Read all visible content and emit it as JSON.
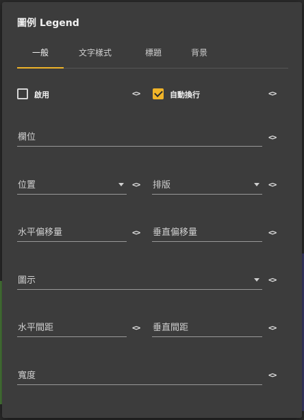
{
  "dialog": {
    "title": "圖例 Legend",
    "tabs": [
      "一般",
      "文字樣式",
      "標題",
      "背景"
    ],
    "active_tab": 0
  },
  "code_glyph": "<>",
  "options": {
    "enable": {
      "label": "啟用",
      "checked": false
    },
    "wrap": {
      "label": "自動換行",
      "checked": true
    }
  },
  "fields": {
    "columns": "欄位",
    "position": "位置",
    "layout": "排版",
    "h_offset": "水平偏移量",
    "v_offset": "垂直偏移量",
    "icon": "圖示",
    "h_spacing": "水平間距",
    "v_spacing": "垂直間距",
    "width": "寬度"
  },
  "colors": {
    "accent": "#f0b429",
    "panel": "#3c3c3c"
  },
  "icons": {
    "code": "code-icon",
    "dropdown": "chevron-down-icon",
    "check": "check-icon"
  }
}
